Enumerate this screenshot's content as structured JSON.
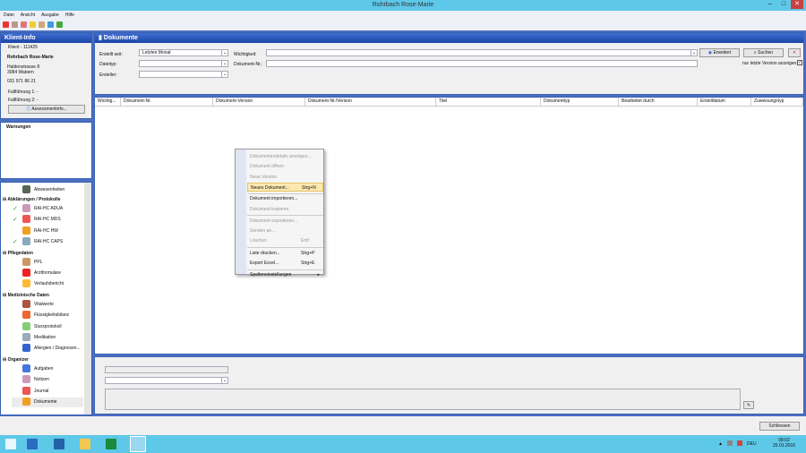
{
  "window": {
    "title": "Rohrbach Rose-Marie",
    "minimize": "–",
    "maximize": "□",
    "close": "✕"
  },
  "menu": [
    "Datei",
    "Ansicht",
    "Ausgabe",
    "Hilfe"
  ],
  "toolbar_icons": [
    "calendar-icon",
    "person-icon",
    "print-icon",
    "note-icon",
    "contact-icon",
    "refresh-icon",
    "sync-icon"
  ],
  "klient": {
    "header": "Klient-Info",
    "id": "Klient - 111425",
    "name": "Rohrbach Rose-Marie",
    "street": "Haldenstrasse 8",
    "city": "3084 Wabern",
    "phone": "031 971 86 21",
    "ff1": "Fallführung 1: -",
    "ff2": "Fallführung 2: -",
    "assessment_button": "Assessmentinfo..."
  },
  "warnungen": {
    "title": "Warnungen"
  },
  "nav": {
    "top": "Abwesenheiten",
    "groups": [
      {
        "label": "Abklärungen / Protokolle",
        "items": [
          {
            "label": "RAI-HC ADUA",
            "checked": true
          },
          {
            "label": "RAI-HC MDS",
            "checked": true
          },
          {
            "label": "RAI-HC HW",
            "checked": false
          },
          {
            "label": "RAI-HC CAPS",
            "checked": true
          }
        ]
      },
      {
        "label": "Pflegedaten",
        "items": [
          {
            "label": "PPL"
          },
          {
            "label": "Arztformulare"
          },
          {
            "label": "Verlaufsbericht"
          }
        ]
      },
      {
        "label": "Medizinische Daten",
        "items": [
          {
            "label": "Vitalwerte"
          },
          {
            "label": "Flüssigkeitsbilanz"
          },
          {
            "label": "Sturzprotokoll"
          },
          {
            "label": "Medikation"
          },
          {
            "label": "Allergien / Diagnosen..."
          }
        ]
      },
      {
        "label": "Organizer",
        "items": [
          {
            "label": "Aufgaben"
          },
          {
            "label": "Notizen"
          },
          {
            "label": "Journal"
          },
          {
            "label": "Dokumente",
            "selected": true
          }
        ]
      }
    ]
  },
  "main": {
    "header": "Dokumente",
    "filters": {
      "erstellt_seit_label": "Erstellt seit:",
      "erstellt_seit_value": "Letzten Monat",
      "dateityp_label": "Dateityp:",
      "ersteller_label": "Ersteller:",
      "wichtigkeit_label": "Wichtigkeit:",
      "dokument_nr_label": "Dokument-Nr.:",
      "erweitert": "Erweitert",
      "suchen": "Suchen",
      "nur_letzte_version": "nur letzte Version anzeigen",
      "nur_letzte_version_checked": true
    },
    "columns": [
      "Wichtig...",
      "Dokument-Nr.",
      "Dokument-Version",
      "Dokument-Nr./Version",
      "Titel",
      "Dokumenttyp",
      "Bearbeitet durch",
      "Erstelldatum",
      "Zuweisungstyp"
    ],
    "rows": []
  },
  "context_menu": [
    {
      "label": "Dokumentendetails anzeigen...",
      "disabled": true
    },
    {
      "label": "Dokument öffnen",
      "disabled": true
    },
    {
      "label": "Neue Version",
      "disabled": true
    },
    {
      "label": "Neues Dokument...",
      "shortcut": "Strg+N",
      "highlighted": true
    },
    {
      "label": "Dokument importieren..."
    },
    {
      "label": "Dokument kopieren",
      "disabled": true
    },
    {
      "label": "Dokument exportieren...",
      "disabled": true
    },
    {
      "label": "Senden an...",
      "disabled": true
    },
    {
      "label": "Löschen",
      "shortcut": "Entf",
      "disabled": true
    },
    {
      "label": "Liste drucken...",
      "shortcut": "Strg+P"
    },
    {
      "label": "Export Excel...",
      "shortcut": "Strg+E"
    },
    {
      "label": "Spalteneinstellungen",
      "submenu": true
    }
  ],
  "footer": {
    "close_button": "Schliessen"
  },
  "taskbar": {
    "lang": "DEU",
    "time": "08:02",
    "date": "25.01.2016"
  },
  "colors": {
    "accent": "#1c46a8",
    "titlebar": "#5ec8e8",
    "highlight": "#fde8b0"
  }
}
